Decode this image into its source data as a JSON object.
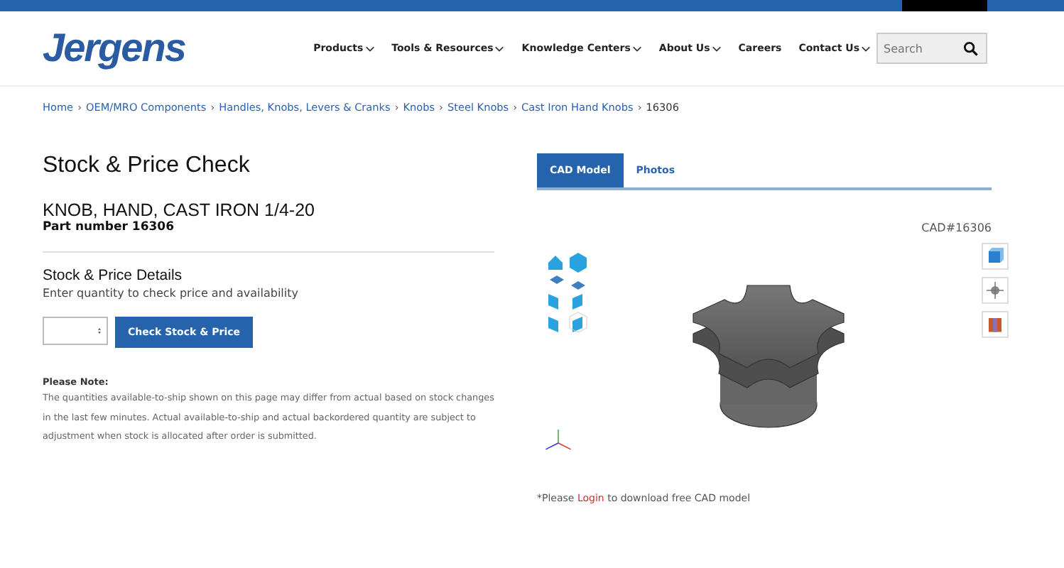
{
  "header": {
    "logo": "Jergens",
    "nav": [
      {
        "label": "Products",
        "dropdown": true
      },
      {
        "label": "Tools & Resources",
        "dropdown": true
      },
      {
        "label": "Knowledge Centers",
        "dropdown": true
      },
      {
        "label": "About Us",
        "dropdown": true
      },
      {
        "label": "Careers",
        "dropdown": false
      },
      {
        "label": "Contact Us",
        "dropdown": true
      }
    ],
    "search": {
      "placeholder": "Search"
    }
  },
  "breadcrumb": {
    "separator": "›",
    "items": [
      {
        "label": "Home",
        "current": false
      },
      {
        "label": "OEM/MRO Components",
        "current": false
      },
      {
        "label": "Handles, Knobs, Levers & Cranks",
        "current": false
      },
      {
        "label": "Knobs",
        "current": false
      },
      {
        "label": "Steel Knobs",
        "current": false
      },
      {
        "label": "Cast Iron Hand Knobs",
        "current": false
      },
      {
        "label": "16306",
        "current": true
      }
    ]
  },
  "stock_check": {
    "title": "Stock & Price Check",
    "product_name": "KNOB, HAND, CAST IRON 1/4-20",
    "part_number": "Part number 16306",
    "details_title": "Stock & Price Details",
    "details_hint": "Enter quantity to check price and availability",
    "button": "Check Stock & Price",
    "note_title": "Please Note:",
    "note_text": "The quantities available-to-ship shown on this page may differ from actual based on stock changes in the last few minutes. Actual available-to-ship and actual backordered quantity are subject to adjustment when stock is allocated after order is submitted."
  },
  "viewer": {
    "tabs": [
      {
        "label": "CAD Model",
        "selected": true
      },
      {
        "label": "Photos",
        "selected": false
      }
    ],
    "cad_number": "CAD#16306",
    "login_prefix": "*Please",
    "login_link": "Login",
    "login_suffix": "to download free CAD model"
  }
}
